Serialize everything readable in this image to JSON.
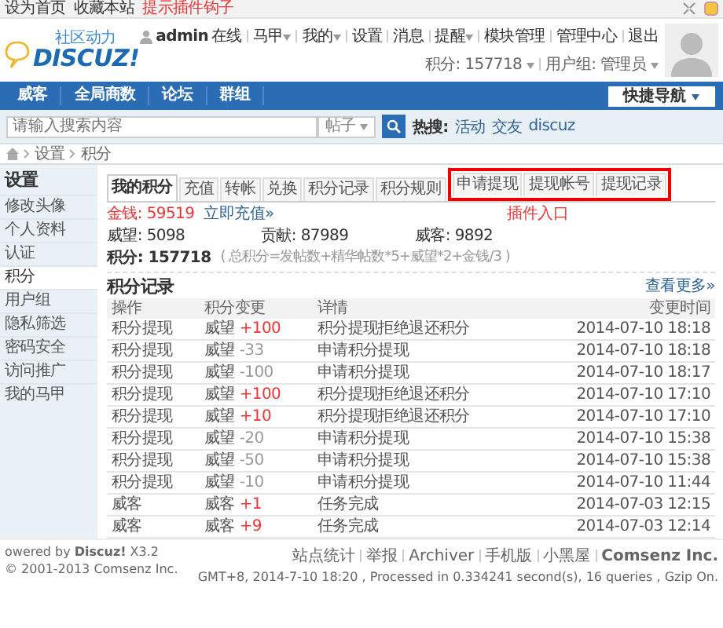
{
  "topbar": {
    "links": [
      "设为首页",
      "收藏本站"
    ],
    "hint": "提示插件钩子"
  },
  "header": {
    "logo_sub": "社区动力",
    "logo": "DISCUZ!",
    "user": "admin",
    "status": "在线",
    "links": [
      {
        "label": "马甲",
        "dropdown": true
      },
      {
        "label": "我的",
        "dropdown": true
      },
      {
        "label": "设置",
        "dropdown": false
      },
      {
        "label": "消息",
        "dropdown": false
      },
      {
        "label": "提醒",
        "dropdown": true
      },
      {
        "label": "模块管理",
        "dropdown": false
      },
      {
        "label": "管理中心",
        "dropdown": false
      },
      {
        "label": "退出",
        "dropdown": false
      }
    ],
    "credits": "积分: 157718",
    "group": "用户组: 管理员"
  },
  "nav": {
    "items": [
      "威客",
      "全局商数",
      "论坛",
      "群组"
    ],
    "quick": "快捷导航"
  },
  "search": {
    "placeholder": "请输入搜索内容",
    "type": "帖子",
    "hot_label": "热搜:",
    "hot": [
      "活动",
      "交友",
      "discuz"
    ]
  },
  "breadcrumb": [
    "设置",
    "积分"
  ],
  "sidebar": {
    "title": "设置",
    "items": [
      {
        "label": "修改头像",
        "selected": false
      },
      {
        "label": "个人资料",
        "selected": false
      },
      {
        "label": "认证",
        "selected": false
      },
      {
        "label": "积分",
        "selected": true
      },
      {
        "label": "用户组",
        "selected": false
      },
      {
        "label": "隐私筛选",
        "selected": false
      },
      {
        "label": "密码安全",
        "selected": false
      },
      {
        "label": "访问推广",
        "selected": false
      },
      {
        "label": "我的马甲",
        "selected": false
      }
    ]
  },
  "tabs": [
    {
      "label": "我的积分",
      "selected": true,
      "plugin": false
    },
    {
      "label": "充值",
      "selected": false,
      "plugin": false
    },
    {
      "label": "转帐",
      "selected": false,
      "plugin": false
    },
    {
      "label": "兑换",
      "selected": false,
      "plugin": false
    },
    {
      "label": "积分记录",
      "selected": false,
      "plugin": false
    },
    {
      "label": "积分规则",
      "selected": false,
      "plugin": false
    },
    {
      "label": "申请提现",
      "selected": false,
      "plugin": true
    },
    {
      "label": "提现帐号",
      "selected": false,
      "plugin": true
    },
    {
      "label": "提现记录",
      "selected": false,
      "plugin": true
    }
  ],
  "callout": "插件入口",
  "money": {
    "label": "金钱: 59519",
    "link": "立即充值»"
  },
  "stats": [
    "威望: 5098",
    "贡献: 87989",
    "威客: 9892"
  ],
  "total": {
    "label": "积分: 157718",
    "formula": "( 总积分=发帖数+精华帖数*5+威望*2+金钱/3 )"
  },
  "records": {
    "title": "积分记录",
    "more": "查看更多»",
    "columns": [
      "操作",
      "积分变更",
      "详情",
      "变更时间"
    ],
    "rows": [
      {
        "action": "积分提现",
        "unit": "威望",
        "change": "+100",
        "kind": "gain",
        "detail": "积分提现拒绝退还积分",
        "time": "2014-07-10 18:18"
      },
      {
        "action": "积分提现",
        "unit": "威望",
        "change": "-33",
        "kind": "loss",
        "detail": "申请积分提现",
        "time": "2014-07-10 18:18"
      },
      {
        "action": "积分提现",
        "unit": "威望",
        "change": "-100",
        "kind": "loss",
        "detail": "申请积分提现",
        "time": "2014-07-10 18:17"
      },
      {
        "action": "积分提现",
        "unit": "威望",
        "change": "+100",
        "kind": "gain",
        "detail": "积分提现拒绝退还积分",
        "time": "2014-07-10 17:10"
      },
      {
        "action": "积分提现",
        "unit": "威望",
        "change": "+10",
        "kind": "gain",
        "detail": "积分提现拒绝退还积分",
        "time": "2014-07-10 17:10"
      },
      {
        "action": "积分提现",
        "unit": "威望",
        "change": "-20",
        "kind": "loss",
        "detail": "申请积分提现",
        "time": "2014-07-10 15:38"
      },
      {
        "action": "积分提现",
        "unit": "威望",
        "change": "-50",
        "kind": "loss",
        "detail": "申请积分提现",
        "time": "2014-07-10 15:38"
      },
      {
        "action": "积分提现",
        "unit": "威望",
        "change": "-10",
        "kind": "loss",
        "detail": "申请积分提现",
        "time": "2014-07-10 11:44"
      },
      {
        "action": "威客",
        "unit": "威客",
        "change": "+1",
        "kind": "gain",
        "detail": "任务完成",
        "time": "2014-07-03 12:15"
      },
      {
        "action": "威客",
        "unit": "威客",
        "change": "+9",
        "kind": "gain",
        "detail": "任务完成",
        "time": "2014-07-03 12:14"
      }
    ]
  },
  "footer": {
    "powered": "owered by **Discuz!** X3.2",
    "copyright": "© 2001-2013 Comsenz Inc.",
    "links": [
      "站点统计",
      "举报",
      "Archiver",
      "手机版",
      "小黑屋"
    ],
    "company": "Comsenz Inc.",
    "info": "GMT+8, 2014-7-10 18:20 , Processed in 0.334241 second(s), 16 queries , Gzip On."
  }
}
